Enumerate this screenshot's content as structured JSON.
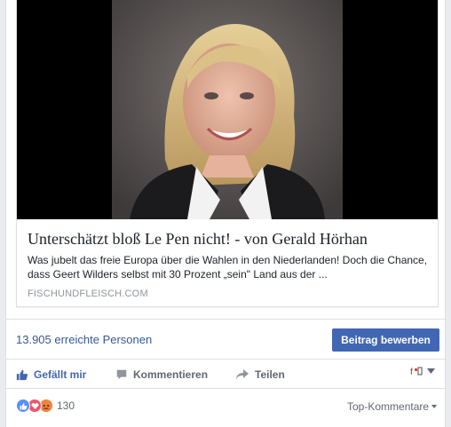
{
  "link": {
    "title": "Unterschätzt bloß Le Pen nicht! - von Gerald Hörhan",
    "description": "Was jubelt das freie Europa über die Wahlen in den Niederlanden! Doch die Chance, dass Geert Wilders selbst mit 30 Prozent „sein\" Land aus der ...",
    "domain": "FISCHUNDFLEISCH.COM"
  },
  "stats": {
    "reach": "13.905 erreichte Personen",
    "promote_label": "Beitrag bewerben"
  },
  "actions": {
    "like": "Gefällt mir",
    "comment": "Kommentieren",
    "share": "Teilen"
  },
  "reactions": {
    "count": "130",
    "types": [
      "like-icon",
      "love-icon",
      "angry-icon"
    ]
  },
  "comments": {
    "sort_label": "Top-Kommentare"
  },
  "colors": {
    "brand": "#4267b2",
    "link": "#365899",
    "muted": "#616770"
  }
}
